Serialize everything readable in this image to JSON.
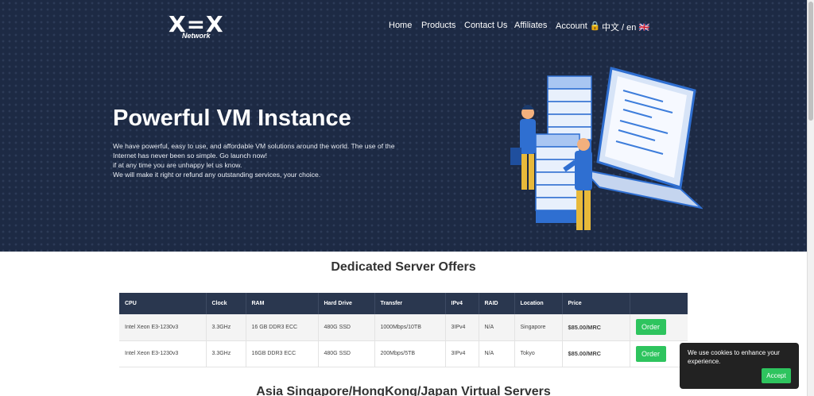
{
  "brand": {
    "logo_mark": "X=X",
    "logo_sub": "Network"
  },
  "nav": {
    "items": [
      {
        "label": "Home"
      },
      {
        "label": "Products"
      },
      {
        "label": "Contact Us"
      },
      {
        "label": "Affiliates"
      },
      {
        "label": "Account 🔒"
      },
      {
        "label": "中文 / en 🇬🇧"
      }
    ]
  },
  "hero": {
    "title": "Powerful VM Instance",
    "lines": [
      "We have powerful, easy to use, and affordable VM solutions around the world. The use of the",
      "Internet has never been so simple. Go launch now!",
      "if at any time you are unhappy let us know.",
      "We will make it right or refund any outstanding services, your choice."
    ]
  },
  "dedicated": {
    "title": "Dedicated Server Offers",
    "headers": [
      "CPU",
      "Clock",
      "RAM",
      "Hard Drive",
      "Transfer",
      "IPv4",
      "RAID",
      "Location",
      "Price",
      ""
    ],
    "rows": [
      {
        "cpu": "Intel Xeon E3-1230v3",
        "clock": "3.3GHz",
        "ram": "16 GB DDR3 ECC",
        "drive": "480G SSD",
        "transfer": "1000Mbps/10TB",
        "ipv4": "3IPv4",
        "raid": "N/A",
        "location": "Singapore",
        "price": "$85.00/MRC",
        "order": "Order"
      },
      {
        "cpu": "Intel Xeon E3-1230v3",
        "clock": "3.3GHz",
        "ram": "16GB DDR3 ECC",
        "drive": "480G SSD",
        "transfer": "200Mbps/5TB",
        "ipv4": "3IPv4",
        "raid": "N/A",
        "location": "Tokyo",
        "price": "$85.00/MRC",
        "order": "Order"
      }
    ]
  },
  "next_section": {
    "title": "Asia Singapore/HongKong/Japan Virtual Servers"
  },
  "cookie": {
    "message": "We use cookies to enhance your experience.",
    "accept": "Accept"
  },
  "colors": {
    "hero_bg": "#1d2a44",
    "table_header": "#2a374f",
    "accent_green": "#2ec45e",
    "price_blue": "#3a7bd5"
  }
}
